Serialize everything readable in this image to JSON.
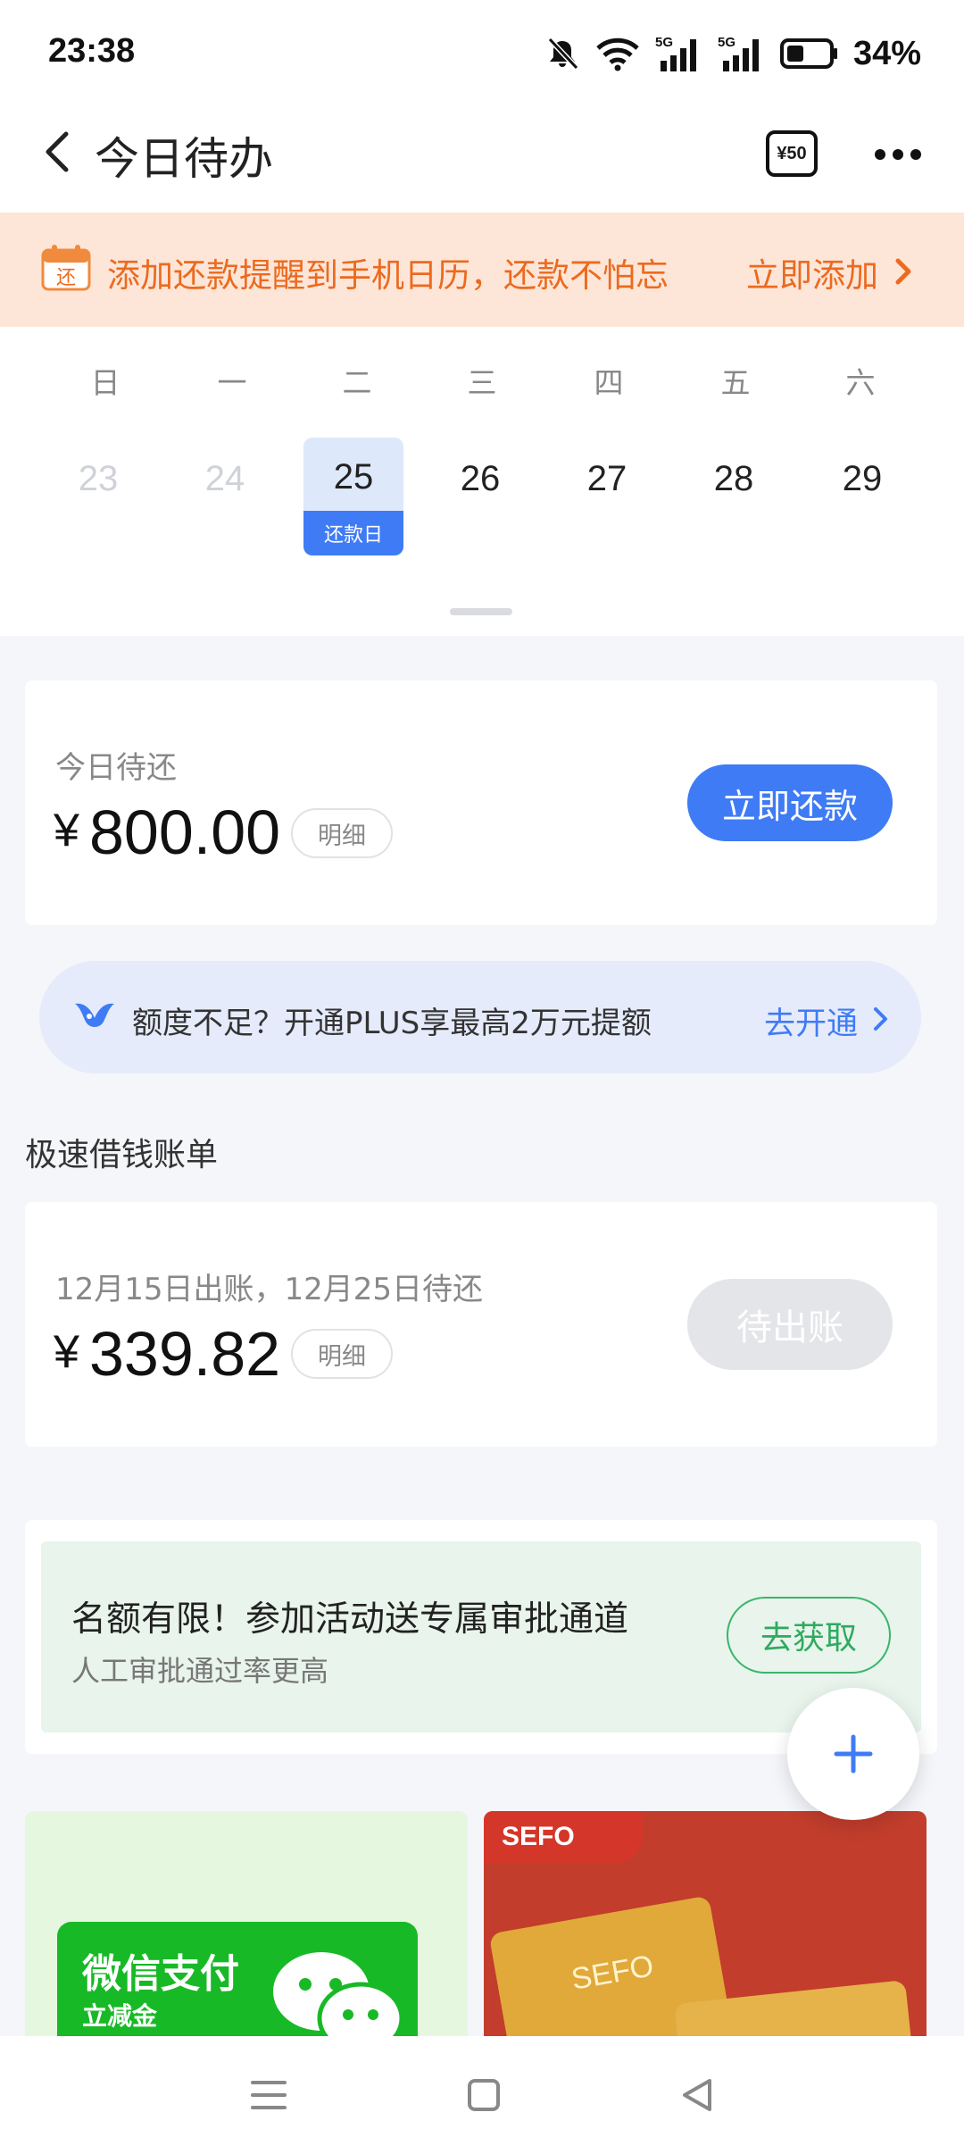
{
  "status_bar": {
    "time": "23:38",
    "battery_percent": "34%",
    "signal_1": "5G",
    "signal_2": "5G",
    "icons": [
      "mute-icon",
      "wifi-icon",
      "signal-5g-icon",
      "signal-5g-icon",
      "battery-icon"
    ]
  },
  "header": {
    "title": "今日待办",
    "coupon_label": "¥50"
  },
  "banner": {
    "calendar_icon_text": "还",
    "text": "添加还款提醒到手机日历，还款不怕忘",
    "action": "立即添加"
  },
  "calendar": {
    "weekdays": [
      "日",
      "一",
      "二",
      "三",
      "四",
      "五",
      "六"
    ],
    "days": [
      "23",
      "24",
      "25",
      "26",
      "27",
      "28",
      "29"
    ],
    "selected_index": 2,
    "selected_tag": "还款日"
  },
  "today_due": {
    "label": "今日待还",
    "currency": "¥",
    "amount": "800.00",
    "detail": "明细",
    "button": "立即还款"
  },
  "plus_banner": {
    "text": "额度不足？开通PLUS享最高2万元提额",
    "action": "去开通"
  },
  "fast_loan": {
    "section_title": "极速借钱账单",
    "subtitle": "12月15日出账，12月25日待还",
    "currency": "¥",
    "amount": "339.82",
    "detail": "明细",
    "button": "待出账"
  },
  "promo": {
    "title": "名额有限！参加活动送专属审批通道",
    "subtitle": "人工审批通过率更高",
    "button": "去获取"
  },
  "tiles": {
    "wechat_title": "微信支付",
    "wechat_sub": "立减金",
    "sefo_tag": "SEFO",
    "sefo_card_text": "SEFO"
  },
  "colors": {
    "accent_blue": "#3f7bf5",
    "banner_orange": "#ec6a1f",
    "banner_bg": "#fde6d8",
    "green": "#2faa5e"
  }
}
